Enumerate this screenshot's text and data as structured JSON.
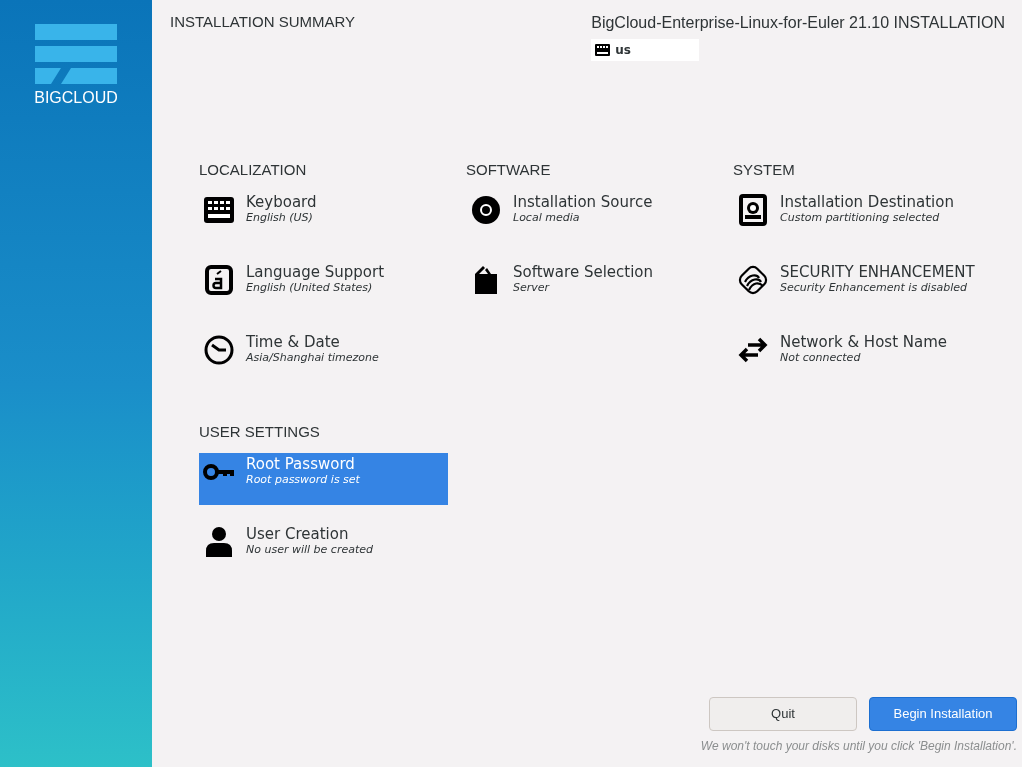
{
  "sidebar": {
    "logo_text": "BIGCLOUD"
  },
  "header": {
    "title": "INSTALLATION SUMMARY",
    "product": "BigCloud-Enterprise-Linux-for-Euler 21.10 INSTALLATION",
    "keyboard_layout": "us"
  },
  "categories": [
    {
      "title": "LOCALIZATION",
      "spokes": [
        {
          "kind": "keyboard",
          "title": "Keyboard",
          "status": "English (US)",
          "selected": false
        },
        {
          "kind": "language",
          "title": "Language Support",
          "status": "English (United States)",
          "selected": false
        },
        {
          "kind": "clock",
          "title": "Time & Date",
          "status": "Asia/Shanghai timezone",
          "selected": false
        }
      ]
    },
    {
      "title": "SOFTWARE",
      "spokes": [
        {
          "kind": "disc",
          "title": "Installation Source",
          "status": "Local media",
          "selected": false
        },
        {
          "kind": "package",
          "title": "Software Selection",
          "status": "Server",
          "selected": false
        }
      ]
    },
    {
      "title": "SYSTEM",
      "spokes": [
        {
          "kind": "drive",
          "title": "Installation Destination",
          "status": "Custom partitioning selected",
          "selected": false
        },
        {
          "kind": "security",
          "title": "SECURITY ENHANCEMENT",
          "status": "Security Enhancement is disabled",
          "selected": false
        },
        {
          "kind": "network",
          "title": "Network & Host Name",
          "status": "Not connected",
          "selected": false
        }
      ]
    },
    {
      "title": "USER SETTINGS",
      "spokes": [
        {
          "kind": "key",
          "title": "Root Password",
          "status": "Root password is set",
          "selected": true
        },
        {
          "kind": "user",
          "title": "User Creation",
          "status": "No user will be created",
          "selected": false
        }
      ]
    }
  ],
  "buttons": [
    {
      "label": "Quit",
      "kind": "secondary"
    },
    {
      "label": "Begin Installation",
      "kind": "primary"
    }
  ],
  "footer_note": "We won't touch your disks until you click 'Begin Installation'."
}
